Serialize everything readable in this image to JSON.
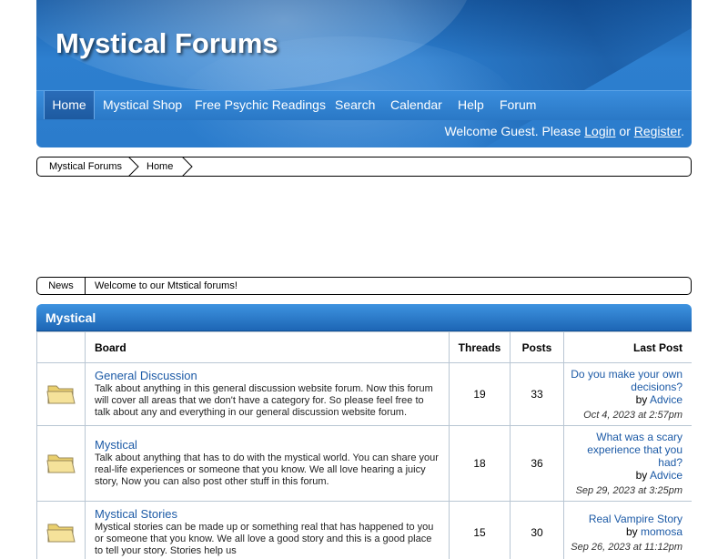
{
  "site": {
    "title": "Mystical Forums"
  },
  "nav": [
    {
      "label": "Home",
      "active": true
    },
    {
      "label": "Mystical Shop"
    },
    {
      "label": "Free Psychic Readings"
    },
    {
      "label": "Search"
    },
    {
      "label": "Calendar"
    },
    {
      "label": "Help"
    },
    {
      "label": "Forum"
    }
  ],
  "welcome": {
    "prefix": "Welcome Guest. Please ",
    "login": "Login",
    "or": " or ",
    "register": "Register",
    "suffix": "."
  },
  "breadcrumb": [
    "Mystical Forums",
    "Home"
  ],
  "news": {
    "label": "News",
    "text": "Welcome to our Mtstical forums!"
  },
  "category": {
    "title": "Mystical"
  },
  "table": {
    "headers": {
      "board": "Board",
      "threads": "Threads",
      "posts": "Posts",
      "last_post": "Last Post"
    },
    "rows": [
      {
        "title": "General Discussion",
        "desc": "Talk about anything in this general discussion website forum. Now this forum will cover all areas that we don't have a category for. So please feel free to talk about any and everything in our general discussion website forum.",
        "threads": "19",
        "posts": "33",
        "lp_title": "Do you make your own decisions?",
        "lp_by": "by ",
        "lp_user": "Advice",
        "lp_date": "Oct 4, 2023 at 2:57pm"
      },
      {
        "title": "Mystical",
        "desc": "Talk about anything that has to do with the mystical world. You can share your real-life experiences or someone that you know. We all love hearing a juicy story, Now you can also post other stuff in this forum.",
        "threads": "18",
        "posts": "36",
        "lp_title": "What was a scary experience that you had?",
        "lp_by": "by ",
        "lp_user": "Advice",
        "lp_date": "Sep 29, 2023 at 3:25pm"
      },
      {
        "title": "Mystical Stories",
        "desc": "Mystical stories can be made up or something real that has happened to you or someone that you know. We all love a good story and this is a good place to tell your story. Stories help us",
        "threads": "15",
        "posts": "30",
        "lp_title": "Real Vampire Story",
        "lp_by": "by ",
        "lp_user": "momosa",
        "lp_date": "Sep 26, 2023 at 11:12pm"
      }
    ]
  },
  "colors": {
    "header_blue": "#2b7ccc",
    "link_blue": "#1c5aa6",
    "folder": "#f2dd8a"
  },
  "icons": {
    "board": "folder-icon",
    "breadcrumb_sep": "chevron-right-icon"
  }
}
